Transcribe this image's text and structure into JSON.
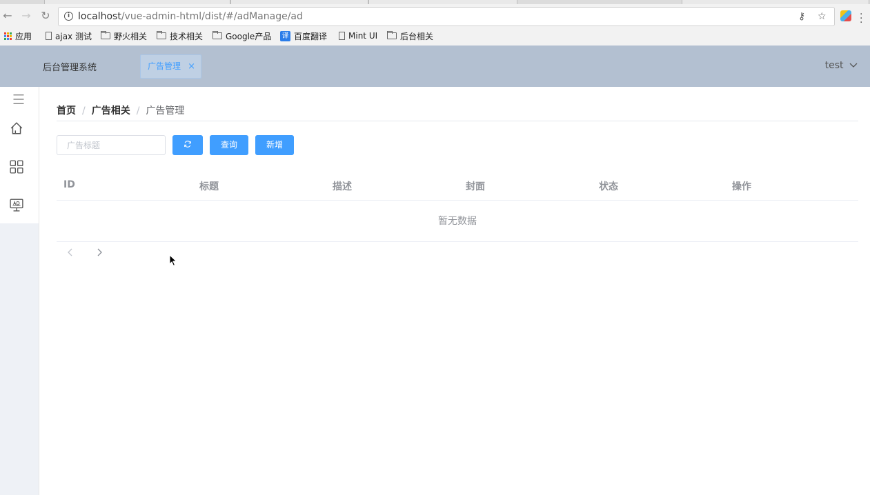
{
  "browser": {
    "url_host": "localhost",
    "url_path": "/vue-admin-html/dist/#/adManage/ad",
    "bookmarks": [
      {
        "label": "应用",
        "icon": "apps-grid-icon"
      },
      {
        "label": "ajax 测试",
        "icon": "page-icon"
      },
      {
        "label": "野火相关",
        "icon": "folder-icon"
      },
      {
        "label": "技术相关",
        "icon": "folder-icon"
      },
      {
        "label": "Google产品",
        "icon": "folder-icon"
      },
      {
        "label": "百度翻译",
        "icon": "baidu-translate-icon"
      },
      {
        "label": "Mint UI",
        "icon": "page-icon"
      },
      {
        "label": "后台相关",
        "icon": "folder-icon"
      }
    ],
    "baidu_glyph": "译"
  },
  "header": {
    "brand": "后台管理系统",
    "open_tab": "广告管理",
    "close_glyph": "×",
    "user": "test"
  },
  "breadcrumb": {
    "home": "首页",
    "section": "广告相关",
    "current": "广告管理",
    "separator": "/"
  },
  "toolbar": {
    "search_placeholder": "广告标题",
    "query_label": "查询",
    "add_label": "新增"
  },
  "table": {
    "columns": [
      "ID",
      "标题",
      "描述",
      "封面",
      "状态",
      "操作"
    ],
    "empty_text": "暂无数据"
  },
  "colors": {
    "primary": "#409eff",
    "header_bg": "#b3c0d1",
    "sidebar_bg": "#eef1f6"
  }
}
